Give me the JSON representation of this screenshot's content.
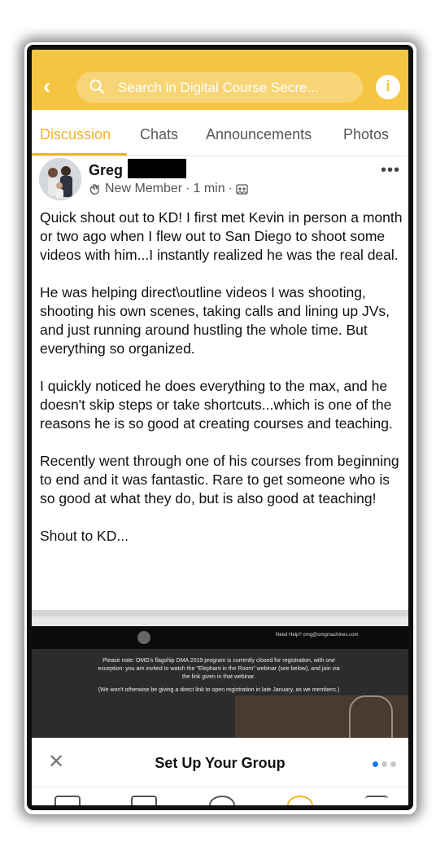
{
  "header": {
    "search_placeholder": "Search in Digital Course Secre...",
    "info_label": "i",
    "back_label": "‹"
  },
  "tabs": [
    {
      "label": "Discussion",
      "active": true
    },
    {
      "label": "Chats",
      "active": false
    },
    {
      "label": "Announcements",
      "active": false
    },
    {
      "label": "Photos",
      "active": false
    }
  ],
  "post": {
    "author_first": "Greg",
    "badge": "New Member",
    "time": "1 min",
    "more_label": "•••",
    "paragraphs": [
      "Quick shout out to KD! I first met Kevin in person a month or two ago when I flew out to San Diego to shoot some videos with him...I instantly realized he was the real deal.",
      "He was helping direct\\outline videos I was shooting, shooting his own scenes, taking calls and lining up JVs, and just running around hustling the whole time. But everything so organized.",
      "I quickly noticed he does everything to the max, and he doesn't skip steps or take shortcuts...which is one of the reasons he is so good at creating courses and teaching.",
      "Recently went through one of his courses from beginning to end and it was fantastic. Rare to get someone who is so good at what they do, but is also good at teaching!",
      "Shout to KD..."
    ]
  },
  "preview": {
    "help_text": "Need Help? omg@omgmachines.com",
    "note_paragraph_1": "Please note: OMG's flagship DMA 2019 program is currently closed for registration, with one exception: you are invited to watch the \"Elephant in the Room\" webinar (see below), and join via the link given in that webinar.",
    "note_paragraph_2": "(We won't otherwise be giving a direct link to open registration in late January, as we members.)"
  },
  "sheet": {
    "close_label": "✕",
    "title": "Set Up Your Group",
    "page_dots": 3,
    "active_dot": 0
  },
  "colors": {
    "accent": "#f5c542",
    "tab_active": "#f0b429",
    "dot_active": "#1877f2"
  }
}
